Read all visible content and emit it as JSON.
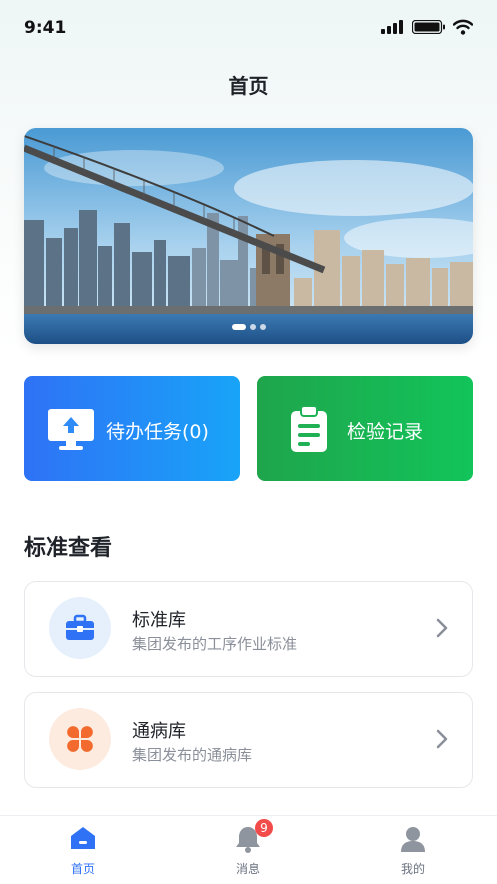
{
  "status_bar": {
    "time": "9:41"
  },
  "page_title": "首页",
  "banner": {
    "slides": 3,
    "active_slide": 1
  },
  "quick_actions": [
    {
      "label": "待办任务(0)",
      "icon": "monitor-upload-icon",
      "color": "#2f72f6"
    },
    {
      "label": "检验记录",
      "icon": "clipboard-icon",
      "color": "#1fa54c"
    }
  ],
  "section_title": "标准查看",
  "list_items": [
    {
      "title": "标准库",
      "subtitle": "集团发布的工序作业标准",
      "icon": "toolbox-icon"
    },
    {
      "title": "通病库",
      "subtitle": "集团发布的通病库",
      "icon": "clover-icon"
    }
  ],
  "tab_bar": [
    {
      "label": "首页",
      "icon": "home-icon",
      "active": true
    },
    {
      "label": "消息",
      "icon": "bell-icon",
      "badge": "9"
    },
    {
      "label": "我的",
      "icon": "user-icon"
    }
  ]
}
